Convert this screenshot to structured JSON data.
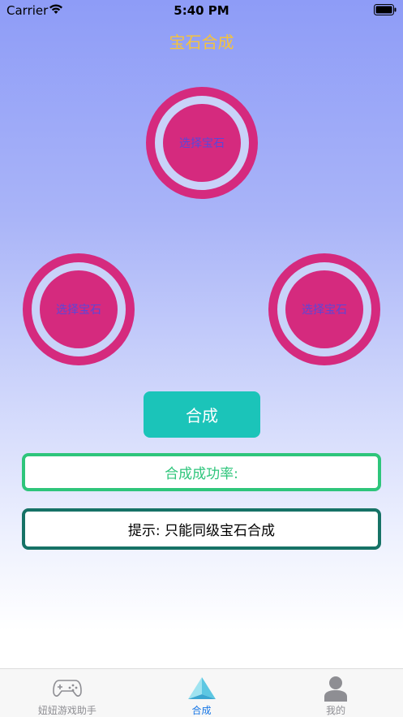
{
  "status_bar": {
    "carrier": "Carrier",
    "time": "5:40 PM"
  },
  "nav": {
    "title": "宝石合成",
    "title_color": "#f5c33b"
  },
  "gem_slots": [
    {
      "label": "选择宝石"
    },
    {
      "label": "选择宝石"
    },
    {
      "label": "选择宝石"
    }
  ],
  "combine_button": {
    "label": "合成",
    "color": "#1bc4b9"
  },
  "success_rate": {
    "label": "合成成功率:",
    "color": "#2ec57b"
  },
  "hint": {
    "label": "提示: 只能同级宝石合成",
    "border_color": "#167266"
  },
  "tab_bar": {
    "items": [
      {
        "label": "妞妞游戏助手",
        "icon": "gamepad-icon",
        "active": false
      },
      {
        "label": "合成",
        "icon": "pyramid-icon",
        "active": true
      },
      {
        "label": "我的",
        "icon": "person-icon",
        "active": false
      }
    ],
    "active_color": "#1877e6"
  }
}
